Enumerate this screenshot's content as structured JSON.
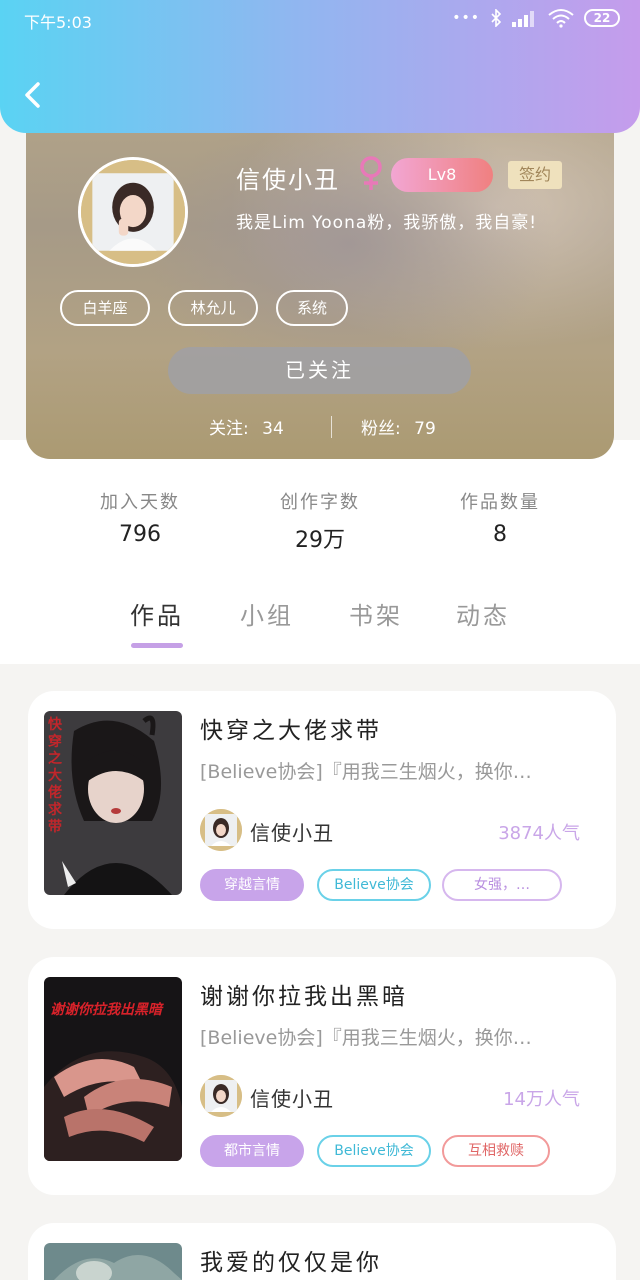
{
  "status_bar": {
    "time": "下午5:03",
    "dots": "•••",
    "battery": "22"
  },
  "profile": {
    "name": "信使小丑",
    "gender_icon": "female-icon",
    "level": "Lv8",
    "sign_badge": "签约",
    "bio": "我是Lim Yoona粉，我骄傲，我自豪!",
    "tags": [
      "白羊座",
      "林允儿",
      "系统"
    ],
    "follow_button": "已关注",
    "following_label": "关注:",
    "following_count": "34",
    "fans_label": "粉丝:",
    "fans_count": "79"
  },
  "stats": [
    {
      "label": "加入天数",
      "value": "796"
    },
    {
      "label": "创作字数",
      "value": "29万"
    },
    {
      "label": "作品数量",
      "value": "8"
    }
  ],
  "tabs": [
    {
      "label": "作品",
      "active": true
    },
    {
      "label": "小组",
      "active": false
    },
    {
      "label": "书架",
      "active": false
    },
    {
      "label": "动态",
      "active": false
    }
  ],
  "works": [
    {
      "title": "快穿之大佬求带",
      "description": "[Believe协会]『用我三生烟火，换你…",
      "author": "信使小丑",
      "popularity": "3874人气",
      "cover_text": "快穿之大佬求带",
      "chips": [
        "穿越言情",
        "Believe协会",
        "女强，…"
      ]
    },
    {
      "title": "谢谢你拉我出黑暗",
      "description": "[Believe协会]『用我三生烟火，换你…",
      "author": "信使小丑",
      "popularity": "14万人气",
      "cover_text": "谢谢你拉我出黑暗",
      "chips": [
        "都市言情",
        "Believe协会",
        "互相救赎"
      ]
    },
    {
      "title": "我爱的仅仅是你"
    }
  ],
  "colors": {
    "header_gradient_start": "#5ad3f3",
    "header_gradient_end": "#c59cec",
    "accent_purple": "#c8a4ea",
    "accent_cyan": "#6ad1e8",
    "accent_red": "#f29a9a"
  }
}
